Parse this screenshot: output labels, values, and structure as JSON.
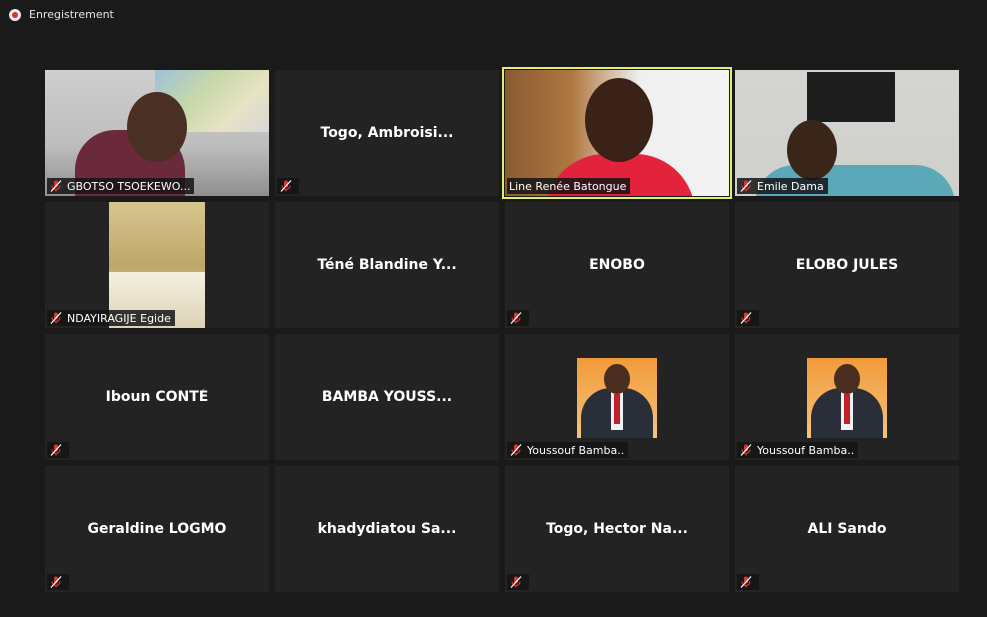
{
  "recording": {
    "label": "Enregistrement"
  },
  "participants": [
    {
      "name": "GBOTSO TSOEKEWO...",
      "video": true
    },
    {
      "name": "Togo,  Ambroisi...",
      "video": false
    },
    {
      "name": "Line Renée Batongue",
      "video": true,
      "active": true
    },
    {
      "name": "Emile Dama",
      "video": true
    },
    {
      "name": "NDAYIRAGIJE Egide",
      "video": true
    },
    {
      "name": "Téné Blandine Y...",
      "video": false
    },
    {
      "name": "ENOBO",
      "video": false
    },
    {
      "name": "ELOBO JULES",
      "video": false
    },
    {
      "name": "Iboun CONTÉ",
      "video": false
    },
    {
      "name": "BAMBA  YOUSS...",
      "video": false
    },
    {
      "name": "Youssouf Bamba..",
      "video": true
    },
    {
      "name": "Youssouf Bamba..",
      "video": true
    },
    {
      "name": "Geraldine LOGMO",
      "video": false
    },
    {
      "name": "khadydiatou  Sa...",
      "video": false
    },
    {
      "name": "Togo,  Hector  Na...",
      "video": false
    },
    {
      "name": "ALI Sando",
      "video": false
    }
  ],
  "colors": {
    "background": "#1a1a1a",
    "tile": "#232323",
    "active_border": "#e3ee6d",
    "mute_icon": "#e0322f"
  },
  "icons": {
    "mute": "microphone-muted-icon",
    "record": "record-icon"
  }
}
